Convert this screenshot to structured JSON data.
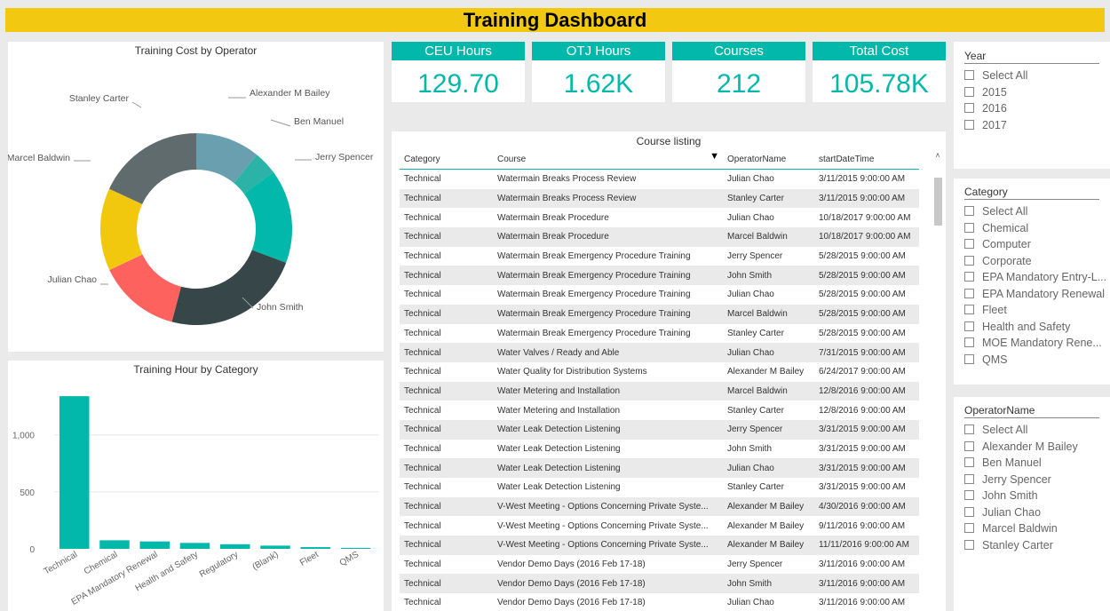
{
  "title": "Training Dashboard",
  "donut": {
    "title": "Training Cost by Operator",
    "slices": [
      {
        "name": "Alexander M Bailey",
        "color": "#6a9fb0"
      },
      {
        "name": "Ben Manuel",
        "color": "#2ab3a6"
      },
      {
        "name": "Jerry Spencer",
        "color": "#01b8aa"
      },
      {
        "name": "John Smith",
        "color": "#374649"
      },
      {
        "name": "Julian Chao",
        "color": "#fd625e"
      },
      {
        "name": "Marcel Baldwin",
        "color": "#f2c80f"
      },
      {
        "name": "Stanley Carter",
        "color": "#5f6b6d"
      }
    ]
  },
  "chart_data": {
    "type": "bar",
    "title": "Training Hour by Category",
    "categories": [
      "Technical",
      "Chemical",
      "EPA Mandatory Renewal",
      "Health and Safety",
      "Regulatory",
      "(Blank)",
      "Fleet",
      "QMS"
    ],
    "values": [
      1340,
      75,
      65,
      52,
      40,
      28,
      15,
      8
    ],
    "ylim": [
      0,
      1450
    ],
    "yticks": [
      0,
      500,
      1000
    ],
    "ytick_labels": [
      "0",
      "500",
      "1,000"
    ],
    "color": "#01b8aa"
  },
  "kpis": [
    {
      "label": "CEU Hours",
      "value": "129.70"
    },
    {
      "label": "OTJ Hours",
      "value": "1.62K"
    },
    {
      "label": "Courses",
      "value": "212"
    },
    {
      "label": "Total Cost",
      "value": "105.78K"
    }
  ],
  "course_listing": {
    "title": "Course listing",
    "columns": [
      "Category",
      "Course",
      "OperatorName",
      "startDateTime"
    ],
    "rows": [
      [
        "Technical",
        "Watermain Breaks Process Review",
        "Julian Chao",
        "3/11/2015 9:00:00 AM"
      ],
      [
        "Technical",
        "Watermain Breaks Process Review",
        "Stanley Carter",
        "3/11/2015 9:00:00 AM"
      ],
      [
        "Technical",
        "Watermain Break Procedure",
        "Julian Chao",
        "10/18/2017 9:00:00 AM"
      ],
      [
        "Technical",
        "Watermain Break Procedure",
        "Marcel Baldwin",
        "10/18/2017 9:00:00 AM"
      ],
      [
        "Technical",
        "Watermain Break Emergency Procedure Training",
        "Jerry Spencer",
        "5/28/2015 9:00:00 AM"
      ],
      [
        "Technical",
        "Watermain Break Emergency Procedure Training",
        "John Smith",
        "5/28/2015 9:00:00 AM"
      ],
      [
        "Technical",
        "Watermain Break Emergency Procedure Training",
        "Julian Chao",
        "5/28/2015 9:00:00 AM"
      ],
      [
        "Technical",
        "Watermain Break Emergency Procedure Training",
        "Marcel Baldwin",
        "5/28/2015 9:00:00 AM"
      ],
      [
        "Technical",
        "Watermain Break Emergency Procedure Training",
        "Stanley Carter",
        "5/28/2015 9:00:00 AM"
      ],
      [
        "Technical",
        "Water Valves / Ready and Able",
        "Julian Chao",
        "7/31/2015 9:00:00 AM"
      ],
      [
        "Technical",
        "Water Quality for Distribution Systems",
        "Alexander M Bailey",
        "6/24/2017 9:00:00 AM"
      ],
      [
        "Technical",
        "Water Metering and Installation",
        "Marcel Baldwin",
        "12/8/2016 9:00:00 AM"
      ],
      [
        "Technical",
        "Water Metering and Installation",
        "Stanley Carter",
        "12/8/2016 9:00:00 AM"
      ],
      [
        "Technical",
        "Water Leak Detection Listening",
        "Jerry Spencer",
        "3/31/2015 9:00:00 AM"
      ],
      [
        "Technical",
        "Water Leak Detection Listening",
        "John Smith",
        "3/31/2015 9:00:00 AM"
      ],
      [
        "Technical",
        "Water Leak Detection Listening",
        "Julian Chao",
        "3/31/2015 9:00:00 AM"
      ],
      [
        "Technical",
        "Water Leak Detection Listening",
        "Stanley Carter",
        "3/31/2015 9:00:00 AM"
      ],
      [
        "Technical",
        "V-West Meeting - Options Concerning Private Syste...",
        "Alexander M Bailey",
        "4/30/2016 9:00:00 AM"
      ],
      [
        "Technical",
        "V-West Meeting - Options Concerning Private Syste...",
        "Alexander M Bailey",
        "9/11/2016 9:00:00 AM"
      ],
      [
        "Technical",
        "V-West Meeting - Options Concerning Private Syste...",
        "Alexander M Bailey",
        "11/11/2016 9:00:00 AM"
      ],
      [
        "Technical",
        "Vendor Demo Days (2016 Feb 17-18)",
        "Jerry Spencer",
        "3/11/2016 9:00:00 AM"
      ],
      [
        "Technical",
        "Vendor Demo Days (2016 Feb 17-18)",
        "John Smith",
        "3/11/2016 9:00:00 AM"
      ],
      [
        "Technical",
        "Vendor Demo Days (2016 Feb 17-18)",
        "Julian Chao",
        "3/11/2016 9:00:00 AM"
      ]
    ]
  },
  "slicers": {
    "year": {
      "title": "Year",
      "items": [
        "Select All",
        "2015",
        "2016",
        "2017"
      ]
    },
    "category": {
      "title": "Category",
      "items": [
        "Select All",
        "Chemical",
        "Computer",
        "Corporate",
        "EPA Mandatory Entry-L...",
        "EPA Mandatory Renewal",
        "Fleet",
        "Health and Safety",
        "MOE Mandatory Rene...",
        "QMS"
      ]
    },
    "operator": {
      "title": "OperatorName",
      "items": [
        "Select All",
        "Alexander M Bailey",
        "Ben Manuel",
        "Jerry Spencer",
        "John Smith",
        "Julian Chao",
        "Marcel Baldwin",
        "Stanley Carter"
      ]
    }
  }
}
